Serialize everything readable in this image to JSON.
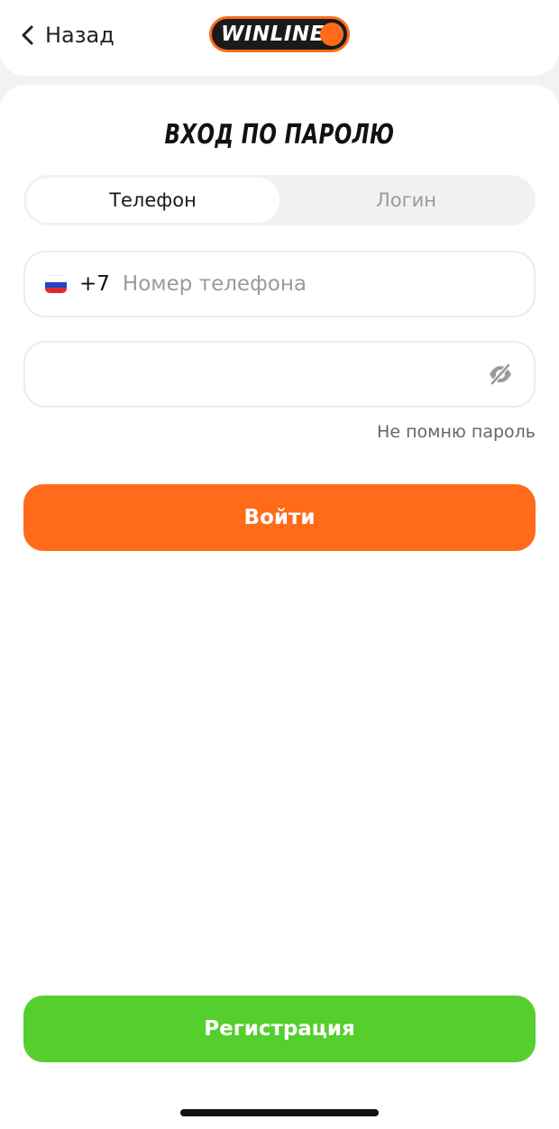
{
  "header": {
    "back_label": "Назад",
    "logo_text": "WINLINE"
  },
  "login": {
    "title": "ВХОД ПО ПАРОЛЮ",
    "tabs": [
      {
        "label": "Телефон",
        "active": true
      },
      {
        "label": "Логин",
        "active": false
      }
    ],
    "phone": {
      "country_code": "+7",
      "placeholder": "Номер телефона",
      "value": ""
    },
    "password": {
      "value": "",
      "visibility_icon": "eye-off-icon"
    },
    "forgot_label": "Не помню пароль",
    "submit_label": "Войти",
    "register_label": "Регистрация"
  },
  "colors": {
    "accent": "#ff6b1a",
    "register": "#55cf2e",
    "logo_bg": "#1a1a1a"
  }
}
